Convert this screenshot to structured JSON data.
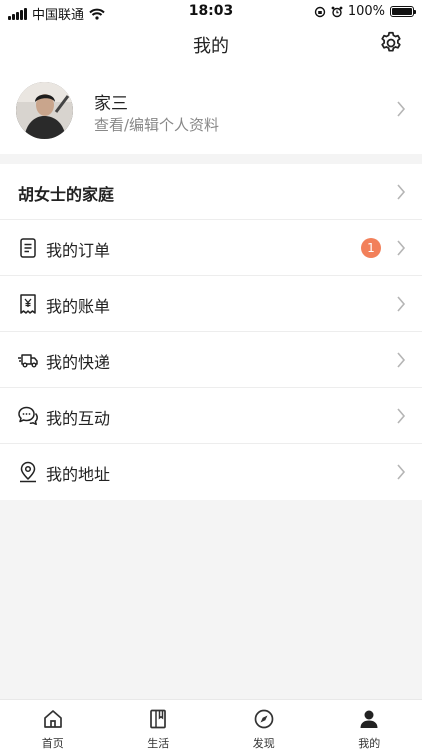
{
  "status_bar": {
    "carrier": "中国联通",
    "time": "18:03",
    "battery_percent": "100%",
    "battery_level": 1.0
  },
  "nav": {
    "title": "我的"
  },
  "profile": {
    "name": "家三",
    "subtitle": "查看/编辑个人资料"
  },
  "menu": {
    "family": "胡女士的家庭",
    "items": [
      {
        "label": "我的订单",
        "icon": "document-icon",
        "badge": "1"
      },
      {
        "label": "我的账单",
        "icon": "receipt-icon"
      },
      {
        "label": "我的快递",
        "icon": "delivery-truck-icon"
      },
      {
        "label": "我的互动",
        "icon": "chat-bubbles-icon"
      },
      {
        "label": "我的地址",
        "icon": "location-pin-icon"
      }
    ]
  },
  "tab_bar": {
    "active": "我的",
    "tabs": [
      {
        "label": "首页",
        "icon": "home-icon"
      },
      {
        "label": "生活",
        "icon": "notebook-icon"
      },
      {
        "label": "发现",
        "icon": "compass-icon"
      },
      {
        "label": "我的",
        "icon": "person-icon"
      }
    ]
  },
  "colors": {
    "badge": "#f2805a",
    "background": "#f4f4f4",
    "text": "#222222",
    "secondary_text": "#888888"
  }
}
